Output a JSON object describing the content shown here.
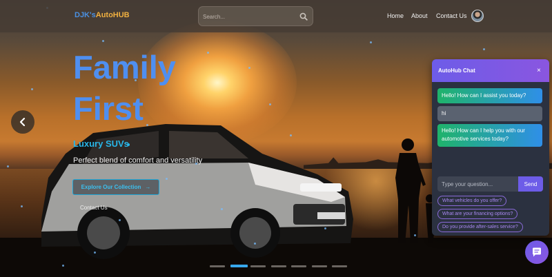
{
  "navbar": {
    "logo_part1": "DJK's",
    "logo_part2": "AutoHUB",
    "search_placeholder": "Search...",
    "links": [
      "Home",
      "About",
      "Contact Us"
    ]
  },
  "hero": {
    "title_line1": "Family",
    "title_line2": "First",
    "subtitle": "Luxury SUVs",
    "tagline": "Perfect blend of comfort and versatility",
    "cta_label": "Explore Our Collection",
    "cta_arrow": "→",
    "contact_label": "Contact Us"
  },
  "carousel": {
    "slide_count": 7,
    "active_index": 1
  },
  "chat": {
    "title": "AutoHub Chat",
    "close_symbol": "×",
    "messages": [
      {
        "from": "bot",
        "text": "Hello! How can I assist you today?"
      },
      {
        "from": "user",
        "text": "hi"
      },
      {
        "from": "bot",
        "text": "Hello! How can I help you with our automotive services today?"
      }
    ],
    "input_placeholder": "Type your question...",
    "send_label": "Send",
    "suggestions": [
      "What vehicles do you offer?",
      "What are your financing options?",
      "Do you provide after-sales service?"
    ]
  },
  "colors": {
    "logo_primary": "#4a90e2",
    "logo_accent": "#f0b040",
    "title": "#4f8ff0",
    "subtitle": "#28b6e8",
    "chat_accent": "#6d5ce8"
  }
}
